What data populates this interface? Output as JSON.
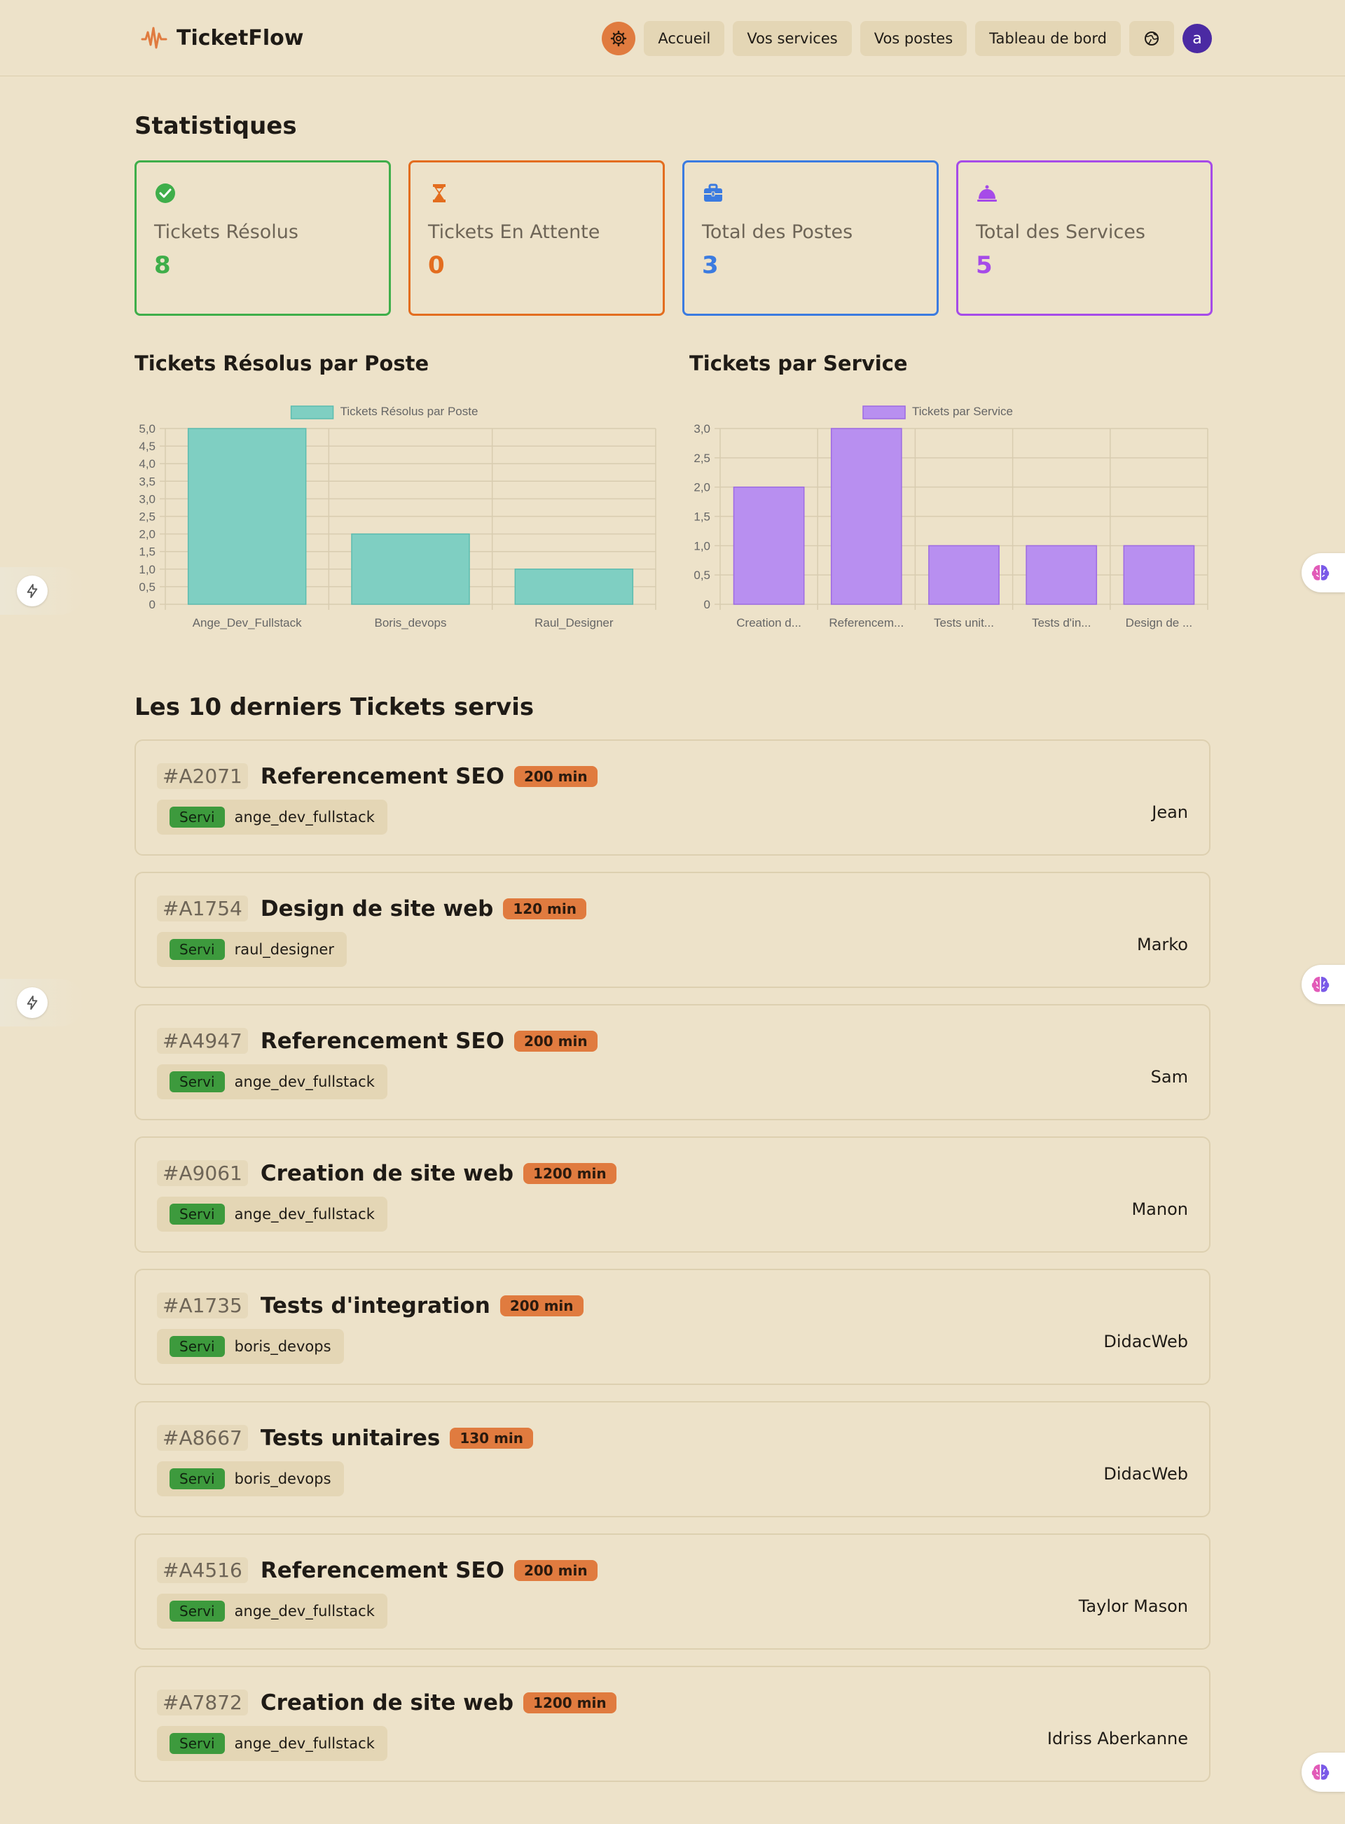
{
  "brand": {
    "name": "TicketFlow"
  },
  "nav": {
    "items": [
      "Accueil",
      "Vos services",
      "Vos postes",
      "Tableau de bord"
    ],
    "avatar_letter": "a"
  },
  "stats_title": "Statistiques",
  "stats": [
    {
      "label": "Tickets Résolus",
      "value": "8",
      "color": "#3fae4a",
      "icon": "check-circle-icon"
    },
    {
      "label": "Tickets En Attente",
      "value": "0",
      "color": "#e36d1f",
      "icon": "hourglass-icon"
    },
    {
      "label": "Total des Postes",
      "value": "3",
      "color": "#3b7be0",
      "icon": "briefcase-icon"
    },
    {
      "label": "Total des Services",
      "value": "5",
      "color": "#a64be8",
      "icon": "service-bell-icon"
    }
  ],
  "chart_data": [
    {
      "type": "bar",
      "title": "Tickets Résolus par Poste",
      "legend": "Tickets Résolus par Poste",
      "categories": [
        "Ange_Dev_Fullstack",
        "Boris_devops",
        "Raul_Designer"
      ],
      "series": [
        {
          "name": "Tickets Résolus par Poste",
          "values": [
            5,
            2,
            1
          ]
        }
      ],
      "ylim": [
        0,
        5
      ],
      "yticks": [
        "0",
        "0,5",
        "1,0",
        "1,5",
        "2,0",
        "2,5",
        "3,0",
        "3,5",
        "4,0",
        "4,5",
        "5,0"
      ],
      "color": "#7fcfc2",
      "border": "#5cbcaf",
      "grid": true,
      "legend_position": "top"
    },
    {
      "type": "bar",
      "title": "Tickets par Service",
      "legend": "Tickets par Service",
      "categories": [
        "Creation d...",
        "Referencem...",
        "Tests unit...",
        "Tests d'in...",
        "Design de ..."
      ],
      "series": [
        {
          "name": "Tickets par Service",
          "values": [
            2,
            3,
            1,
            1,
            1
          ]
        }
      ],
      "ylim": [
        0,
        3
      ],
      "yticks": [
        "0",
        "0,5",
        "1,0",
        "1,5",
        "2,0",
        "2,5",
        "3,0"
      ],
      "color": "#b88ff0",
      "border": "#9d6ae3",
      "grid": true,
      "legend_position": "top"
    }
  ],
  "tickets_title": "Les 10 derniers Tickets servis",
  "tickets": [
    {
      "num": "#A2071",
      "service": "Referencement SEO",
      "duration": "200 min",
      "status": "Servi",
      "agent": "ange_dev_fullstack",
      "client": "Jean"
    },
    {
      "num": "#A1754",
      "service": "Design de site web",
      "duration": "120 min",
      "status": "Servi",
      "agent": "raul_designer",
      "client": "Marko"
    },
    {
      "num": "#A4947",
      "service": "Referencement SEO",
      "duration": "200 min",
      "status": "Servi",
      "agent": "ange_dev_fullstack",
      "client": "Sam"
    },
    {
      "num": "#A9061",
      "service": "Creation de site web",
      "duration": "1200 min",
      "status": "Servi",
      "agent": "ange_dev_fullstack",
      "client": "Manon"
    },
    {
      "num": "#A1735",
      "service": "Tests d'integration",
      "duration": "200 min",
      "status": "Servi",
      "agent": "boris_devops",
      "client": "DidacWeb"
    },
    {
      "num": "#A8667",
      "service": "Tests unitaires",
      "duration": "130 min",
      "status": "Servi",
      "agent": "boris_devops",
      "client": "DidacWeb"
    },
    {
      "num": "#A4516",
      "service": "Referencement SEO",
      "duration": "200 min",
      "status": "Servi",
      "agent": "ange_dev_fullstack",
      "client": "Taylor Mason"
    },
    {
      "num": "#A7872",
      "service": "Creation de site web",
      "duration": "1200 min",
      "status": "Servi",
      "agent": "ange_dev_fullstack",
      "client": "Idriss Aberkanne"
    }
  ]
}
